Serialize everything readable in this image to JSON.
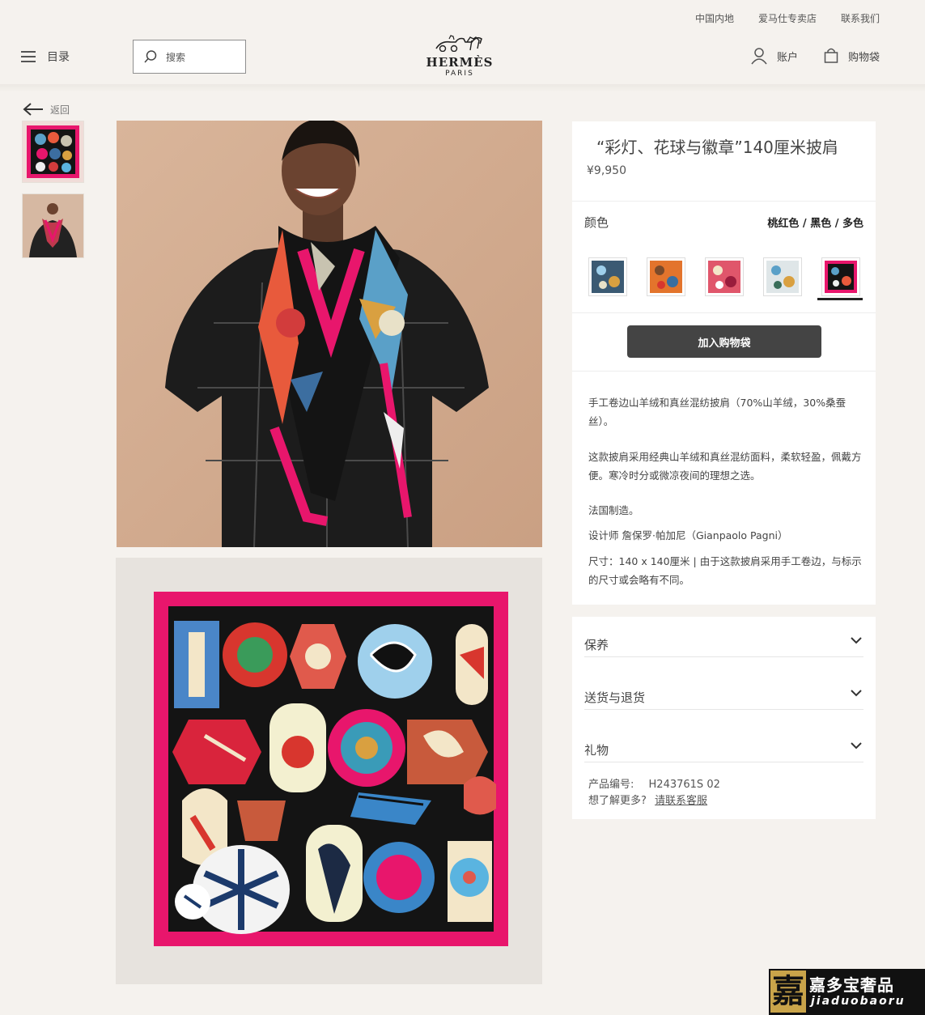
{
  "topbar": {
    "links": [
      "中国内地",
      "爱马仕专卖店",
      "联系我们"
    ]
  },
  "header": {
    "menu_label": "目录",
    "search_placeholder": "搜索",
    "logo_name": "HERMÈS",
    "logo_city": "PARIS",
    "account_label": "账户",
    "bag_label": "购物袋"
  },
  "back_label": "返回",
  "product": {
    "title": "“彩灯、花球与徽章”140厘米披肩",
    "price": "¥9,950",
    "color_label": "颜色",
    "color_value": "桃红色 / 黑色 / 多色",
    "swatch_colors": [
      "#3b5a73",
      "#e3742c",
      "#e0566b",
      "#b8c7cc",
      "#6d1f38"
    ],
    "selected_swatch": 4,
    "add_to_bag": "加入购物袋",
    "description": [
      "手工卷边山羊绒和真丝混纺披肩（70%山羊绒，30%桑蚕丝）。",
      "这款披肩采用经典山羊绒和真丝混纺面料，柔软轻盈，佩戴方便。寒冷时分或微凉夜间的理想之选。",
      "法国制造。",
      "设计师 詹保罗·帕加尼（Gianpaolo Pagni）",
      "尺寸：140 x 140厘米 | 由于这款披肩采用手工卷边，与标示的尺寸或会略有不同。"
    ],
    "accordion": [
      "保养",
      "送货与退货",
      "礼物"
    ],
    "sku_label": "产品编号:",
    "sku_value": "H243761S 02",
    "help_text": "想了解更多?",
    "help_link": "请联系客服"
  },
  "watermark": {
    "glyph": "嘉",
    "brand": "嘉多宝奢品",
    "latin": "jiaduobaoru"
  },
  "colors": {
    "scarf_border": "#e8166c",
    "scarf_ground": "#141414",
    "button": "#444444",
    "background": "#f5f2ee"
  }
}
